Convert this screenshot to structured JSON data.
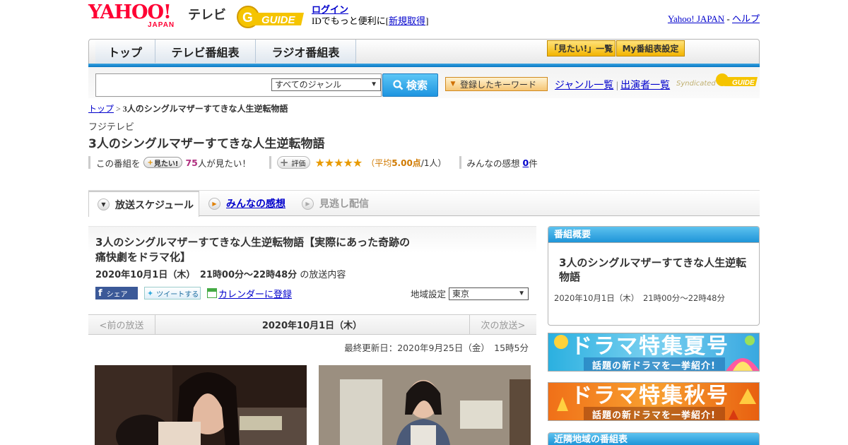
{
  "header": {
    "logo_yahoo": "YAHOO!",
    "logo_japan": "JAPAN",
    "logo_tv": "テレビ",
    "logo_gguide": "G-GUIDE",
    "login": "ログイン",
    "login_note_pre": "IDでもっと便利に[",
    "register": "新規取得",
    "login_note_post": "]",
    "yahoo_japan_link": "Yahoo! JAPAN",
    "separator": "-",
    "help_link": "ヘルプ"
  },
  "nav": {
    "tabs": [
      {
        "label": "トップ"
      },
      {
        "label": "テレビ番組表"
      },
      {
        "label": "ラジオ番組表"
      }
    ],
    "mitai_list": "「見たい!」一覧",
    "my_schedule": "My番組表設定"
  },
  "search": {
    "placeholder": "",
    "genre_selected": "すべてのジャンル",
    "button_label": "検索",
    "keyword_button": "登録したキーワード",
    "genre_list": "ジャンル一覧",
    "link_sep": "|",
    "performer_list": "出演者一覧",
    "syndicated": "Syndicated"
  },
  "breadcrumb": {
    "top": "トップ",
    "sep": ">",
    "current": "3人のシングルマザーすてきな人生逆転物語"
  },
  "program": {
    "station": "フジテレビ",
    "title": "3人のシングルマザーすてきな人生逆転物語",
    "this_program": "この番組を",
    "mitai_button": "見たい!",
    "mitai_count": "75",
    "mitai_suffix": "人が見たい！",
    "hyoka_button": "評価",
    "stars": "★★★★★",
    "rating": 5.0,
    "avg_pre": "（平均",
    "avg_value": "5.00点",
    "avg_post": "/1人）",
    "reviews_label": "みんなの感想",
    "reviews_count": "0",
    "reviews_suffix": "件"
  },
  "tabs": [
    {
      "label": "放送スケジュール",
      "active": true
    },
    {
      "label": "みんなの感想",
      "active": false
    },
    {
      "label": "見逃し配信",
      "active": false
    }
  ],
  "episode": {
    "title": "3人のシングルマザーすてきな人生逆転物語【実際にあった奇跡の痛快劇をドラマ化】",
    "date": "2020年10月1日（木）　21時00分～22時48分",
    "date_suffix": "の放送内容",
    "share_fb": "シェア",
    "share_tw": "ツイートする",
    "calendar": "カレンダーに登録",
    "region_label": "地域設定",
    "region_value": "東京",
    "prev": "<前の放送",
    "current_date": "2020年10月1日（木）",
    "next": "次の放送>",
    "updated": "最終更新日：2020年9月25日（金）　15時5分"
  },
  "sidebar": {
    "overview_head": "番組概要",
    "title": "3人のシングルマザーすてきな人生逆転物語",
    "time": "2020年10月1日（木）　21時00分～22時48分",
    "banner1_main": "ドラマ特集夏号",
    "banner1_sub": "話題の新ドラマを一挙紹介!",
    "banner2_main": "ドラマ特集秋号",
    "banner2_sub": "話題の新ドラマを一挙紹介!",
    "nearby_head": "近隣地域の番組表"
  },
  "colors": {
    "yahoo_red": "#ff0033",
    "accent_blue": "#1f95d8",
    "star_orange": "#e89a00",
    "link_blue": "#0000cc"
  }
}
